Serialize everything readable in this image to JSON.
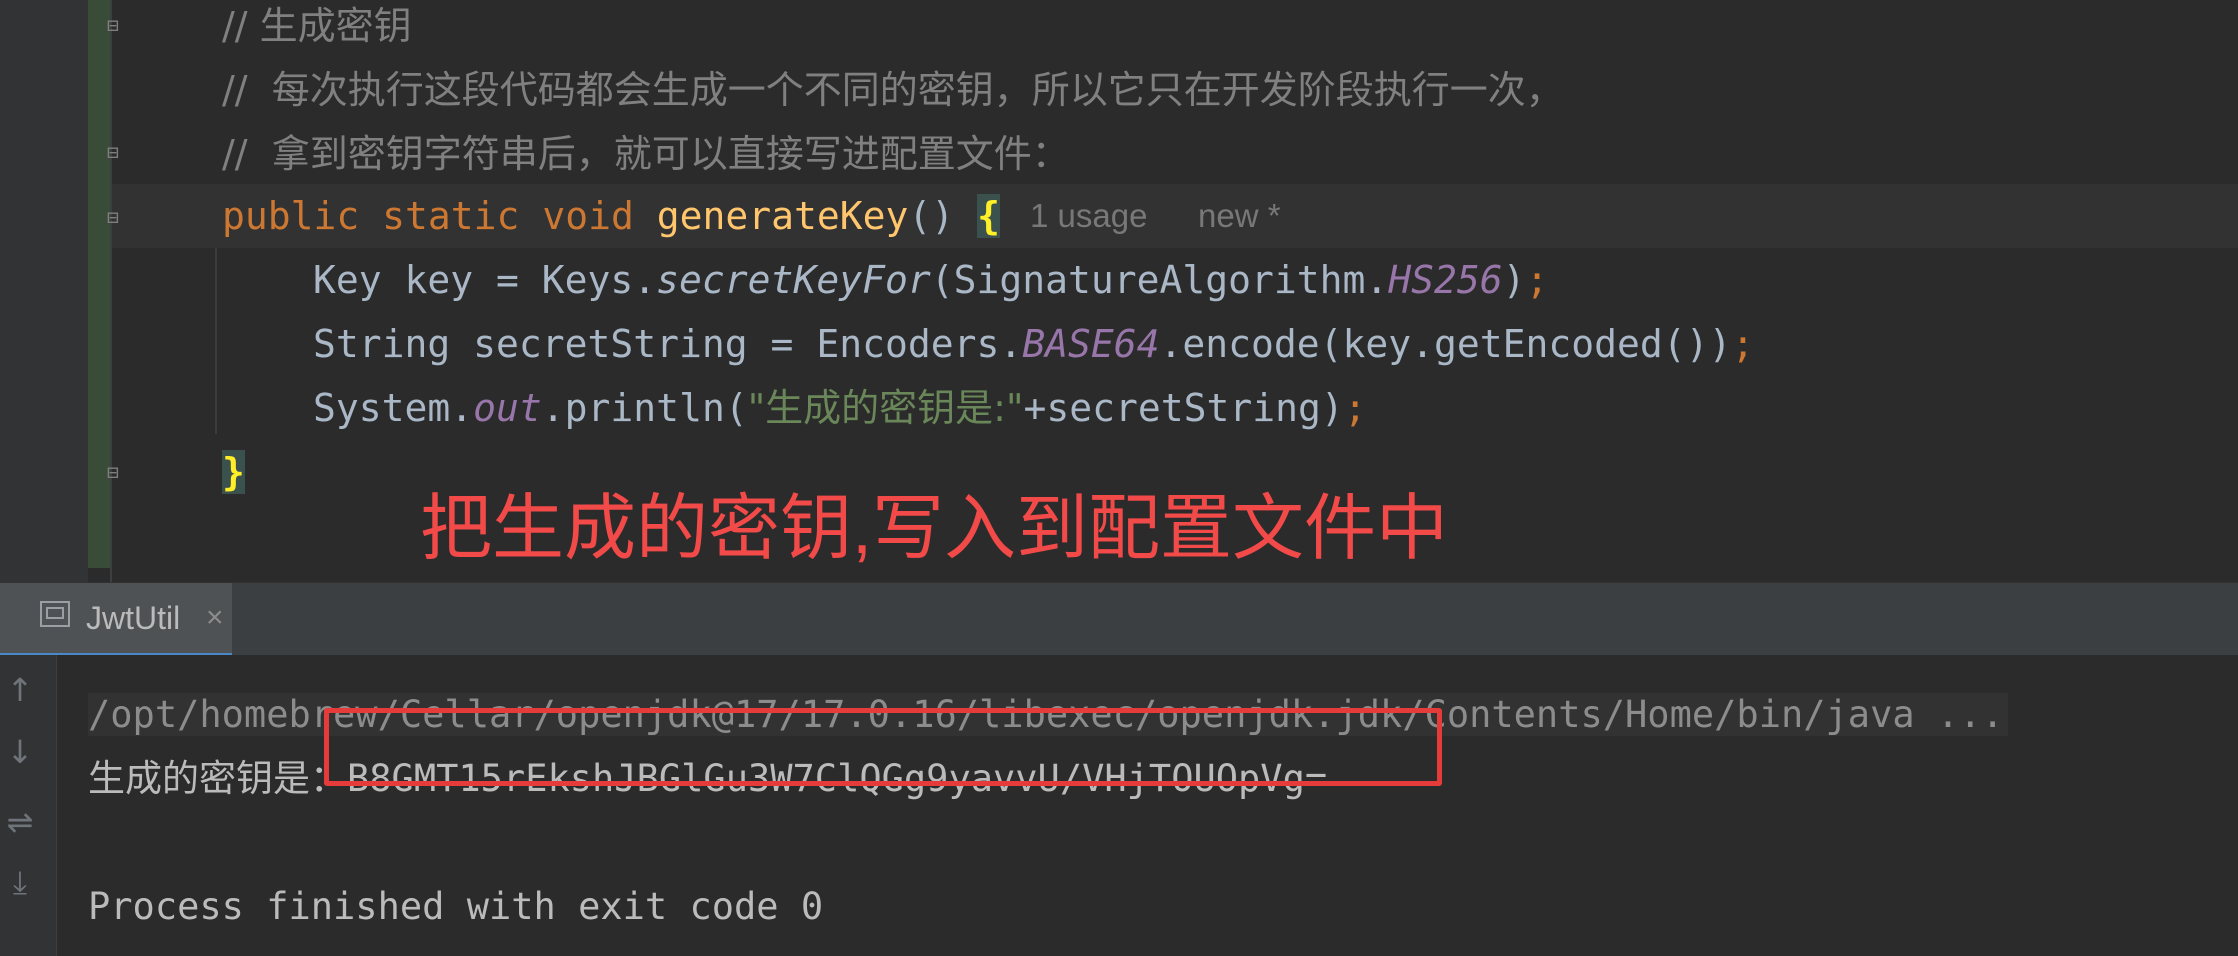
{
  "editor": {
    "comment1": "// 生成密钥",
    "comment2": "//  每次执行这段代码都会生成一个不同的密钥，所以它只在开发阶段执行一次，",
    "comment3": "//  拿到密钥字符串后，就可以直接写进配置文件：",
    "kw_public": "public",
    "kw_static": "static",
    "kw_void": "void",
    "method_name": "generateKey",
    "parens": "()",
    "open_brace": "{",
    "usage_hint": "1 usage",
    "new_hint": "new *",
    "l5_a": "Key key = Keys.",
    "l5_b": "secretKeyFor",
    "l5_c": "(SignatureAlgorithm.",
    "l5_d": "HS256",
    "l5_e": ")",
    "semicolon": ";",
    "l6_a": "String secretString = Encoders.",
    "l6_b": "BASE64",
    "l6_c": ".encode(key.getEncoded())",
    "l7_a": "System.",
    "l7_b": "out",
    "l7_c": ".println(",
    "l7_d": "\"生成的密钥是:\"",
    "l7_e": "+secretString)",
    "close_brace": "}"
  },
  "annotation": "把生成的密钥,写入到配置文件中",
  "run_tab": {
    "label": "JwtUtil",
    "close": "×"
  },
  "console": {
    "command": "/opt/homebrew/Cellar/openjdk@17/17.0.16/libexec/openjdk.jdk/Contents/Home/bin/java ...",
    "key_label": "生成的密钥是：",
    "key_value": "B8GMT15rEkshJBGlGu3W7ClQGg9yavvU/VHjTOUOpVg=",
    "exit_message": "Process finished with exit code 0"
  },
  "icons": [
    "fold-icon",
    "console-tab-icon",
    "close-icon",
    "arrow-up-icon",
    "arrow-down-icon",
    "soft-wrap-icon",
    "scroll-to-end-icon"
  ],
  "colors": {
    "annotation": "#f24a48",
    "highlight_box": "#e53b3b",
    "keyword": "#cc7832",
    "method": "#ffc66d",
    "string": "#6a8759"
  }
}
